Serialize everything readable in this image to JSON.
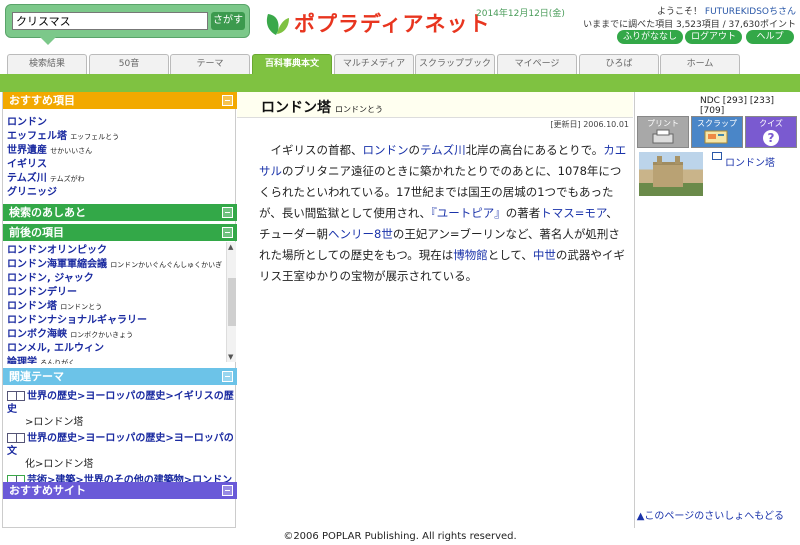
{
  "header": {
    "search_value": "クリスマス",
    "search_button": "さがす",
    "logo_text": "ポプラディアネット",
    "date": "2014年12月12日(金)",
    "greeting_prefix": "ようこそ！",
    "username": "FUTUREKIDSOちさん",
    "stats": "いままでに調べた項目 3,523項目 / 37,630ポイント",
    "furigana_button": "ふりがななし",
    "logout_button": "ログアウト",
    "help_button": "ヘルプ"
  },
  "tabs": [
    "検索結果",
    "50音",
    "テーマ",
    "百科事典本文",
    "マルチメディア",
    "スクラップブック",
    "マイページ",
    "ひろば",
    "ホーム"
  ],
  "active_tab": "百科事典本文",
  "sidebar": {
    "recommended_title": "おすすめ項目",
    "recommended": [
      {
        "label": "ロンドン",
        "ruby": ""
      },
      {
        "label": "エッフェル塔",
        "ruby": "エッフェルとう"
      },
      {
        "label": "世界遺産",
        "ruby": "せかいいさん"
      },
      {
        "label": "イギリス",
        "ruby": ""
      },
      {
        "label": "テムズ川",
        "ruby": "テムズがわ"
      },
      {
        "label": "グリニッジ",
        "ruby": ""
      }
    ],
    "search_history_title": "検索のあしあと",
    "neighbors_title": "前後の項目",
    "neighbors": [
      {
        "label": "ロンドンオリンピック",
        "ruby": ""
      },
      {
        "label": "ロンドン海軍軍縮会議",
        "ruby": "ロンドンかいぐんぐんしゅくかいぎ"
      },
      {
        "label": "ロンドン, ジャック",
        "ruby": ""
      },
      {
        "label": "ロンドンデリー",
        "ruby": ""
      },
      {
        "label": "ロンドン塔",
        "ruby": "ロンドンとう"
      },
      {
        "label": "ロンドンナショナルギャラリー",
        "ruby": ""
      },
      {
        "label": "ロンボク海峡",
        "ruby": "ロンボクかいきょう"
      },
      {
        "label": "ロンメル, エルウィン",
        "ruby": ""
      },
      {
        "label": "論理学",
        "ruby": "ろんりがく"
      }
    ],
    "related_title": "関連テーマ",
    "related": [
      {
        "line1": "世界の歴史>ヨーロッパの歴史>イギリスの歴史",
        "line2": ">ロンドン塔"
      },
      {
        "line1": "世界の歴史>ヨーロッパの歴史>ヨーロッパの文",
        "line2": "化>ロンドン塔"
      },
      {
        "line1": "芸術>建築>世界のその他の建築物>ロンドン",
        "line2": "塔"
      }
    ],
    "sites_title": "おすすめサイト"
  },
  "article": {
    "title": "ロンドン塔",
    "title_ruby": "ロンドンとう",
    "ndc": "NDC [293] [233] [709]",
    "updated": "[更新日] 2006.10.01",
    "p1": "イギリスの首都、",
    "link1": "ロンドン",
    "p2": "の",
    "link2": "テムズ川",
    "p3": "北岸の高台にあるとりで。",
    "link3": "カエサル",
    "p4": "のブリタニア遠征のときに築かれたとりでのあとに、1078年につくられたといわれている。17世紀までは国王の居城の1つでもあったが、長い間監獄として使用され、",
    "link4": "『ユートピア』",
    "p5": "の著者",
    "link5": "トマス=モア",
    "p6": "、チューダー朝",
    "link6": "ヘンリー8世",
    "p7": "の王妃アン=ブーリンなど、著名人が処刑された場所としての歴史をもつ。現在は",
    "link7": "博物館",
    "p8": "として、",
    "link8": "中世",
    "p9": "の武器やイギリス王室ゆかりの宝物が展示されている。"
  },
  "tools": {
    "print": "プリント",
    "scrap": "スクラップ",
    "quiz": "クイズ",
    "image_label": "ロンドン塔",
    "back_to_top": "▲このページのさいしょへもどる"
  },
  "footer": "©2006 POPLAR Publishing. All rights reserved."
}
